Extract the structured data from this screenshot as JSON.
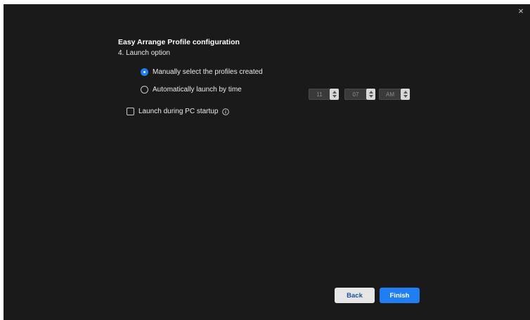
{
  "window": {
    "close_symbol": "×"
  },
  "header": {
    "title": "Easy Arrange Profile configuration",
    "subtitle": "4. Launch option"
  },
  "options": {
    "manual_label": "Manually select the profiles created",
    "manual_selected": true,
    "auto_label": "Automatically launch by time",
    "auto_selected": false
  },
  "time": {
    "hour": "11",
    "minute": "07",
    "period": "AM"
  },
  "startup": {
    "label": "Launch during PC startup",
    "checked": false,
    "info_icon": "info-icon"
  },
  "footer": {
    "back_label": "Back",
    "finish_label": "Finish"
  },
  "colors": {
    "background": "#1a1a1a",
    "accent": "#1f7ff2",
    "back_button": "#e6e6e6"
  }
}
